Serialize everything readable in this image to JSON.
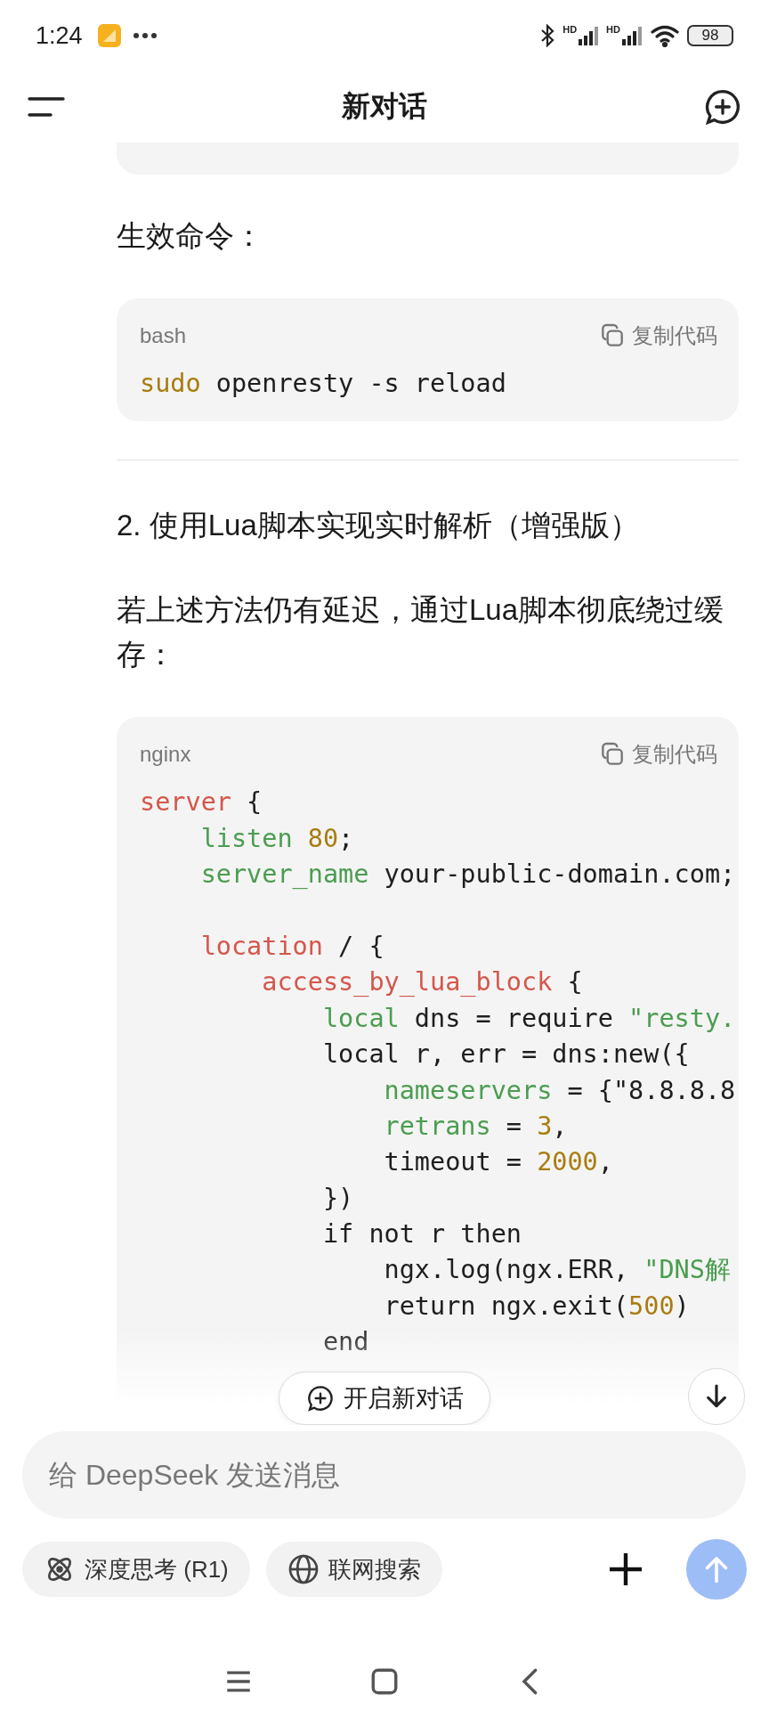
{
  "status_bar": {
    "time": "1:24",
    "signals": [
      {
        "label": "HD"
      },
      {
        "label": "HD"
      }
    ],
    "battery": "98"
  },
  "header": {
    "title": "新对话"
  },
  "content": {
    "intro": "生效命令：",
    "bash_block": {
      "language": "bash",
      "copy_label": "复制代码",
      "lines": [
        {
          "kind": "code",
          "tokens": [
            {
              "text": "sudo",
              "kind": "command"
            },
            {
              "text": " openresty -s reload",
              "kind": "plain"
            }
          ]
        }
      ]
    },
    "heading": "2. 使用Lua脚本实现实时解析（增强版）",
    "paragraph": "若上述方法仍有延迟，通过Lua脚本彻底绕过缓存：",
    "nginx_block": {
      "language": "nginx",
      "copy_label": "复制代码",
      "lines": [
        {
          "kind": "code",
          "tokens": [
            {
              "text": "server",
              "kind": "keyword"
            },
            {
              "text": " {",
              "kind": "plain"
            }
          ]
        },
        {
          "kind": "code",
          "tokens": [
            {
              "text": "    listen ",
              "kind": "name"
            },
            {
              "text": "80",
              "kind": "number"
            },
            {
              "text": ";",
              "kind": "plain"
            }
          ]
        },
        {
          "kind": "code",
          "tokens": [
            {
              "text": "    server_name",
              "kind": "name"
            },
            {
              "text": " your-public-domain.com;",
              "kind": "plain"
            }
          ]
        },
        {
          "kind": "blank"
        },
        {
          "kind": "code",
          "tokens": [
            {
              "text": "    location",
              "kind": "keyword"
            },
            {
              "text": " / {",
              "kind": "plain"
            }
          ]
        },
        {
          "kind": "code",
          "tokens": [
            {
              "text": "        access_by_lua_block",
              "kind": "keyword"
            },
            {
              "text": " {",
              "kind": "plain"
            }
          ]
        },
        {
          "kind": "code",
          "tokens": [
            {
              "text": "            local",
              "kind": "name"
            },
            {
              "text": " dns = require ",
              "kind": "plain"
            },
            {
              "text": "\"resty.",
              "kind": "string"
            }
          ]
        },
        {
          "kind": "code",
          "tokens": [
            {
              "text": "            local r, err = dns:new({",
              "kind": "plain"
            }
          ]
        },
        {
          "kind": "code",
          "tokens": [
            {
              "text": "                nameservers",
              "kind": "name"
            },
            {
              "text": " = {\"8.8.8.8",
              "kind": "plain"
            }
          ]
        },
        {
          "kind": "code",
          "tokens": [
            {
              "text": "                retrans",
              "kind": "name"
            },
            {
              "text": " = ",
              "kind": "plain"
            },
            {
              "text": "3",
              "kind": "number"
            },
            {
              "text": ",",
              "kind": "plain"
            }
          ]
        },
        {
          "kind": "code",
          "tokens": [
            {
              "text": "                timeout = ",
              "kind": "plain"
            },
            {
              "text": "2000",
              "kind": "number"
            },
            {
              "text": ",",
              "kind": "plain"
            }
          ]
        },
        {
          "kind": "code",
          "tokens": [
            {
              "text": "            })",
              "kind": "plain"
            }
          ]
        },
        {
          "kind": "code",
          "tokens": [
            {
              "text": "            if not r then",
              "kind": "plain"
            }
          ]
        },
        {
          "kind": "code",
          "tokens": [
            {
              "text": "                ngx.log(ngx.ERR, ",
              "kind": "plain"
            },
            {
              "text": "\"DNS解",
              "kind": "string"
            }
          ]
        },
        {
          "kind": "code",
          "tokens": [
            {
              "text": "                return ngx.exit(",
              "kind": "plain"
            },
            {
              "text": "500",
              "kind": "number"
            },
            {
              "text": ")",
              "kind": "plain"
            }
          ]
        },
        {
          "kind": "code",
          "tokens": [
            {
              "text": "            end",
              "kind": "plain"
            }
          ]
        }
      ]
    },
    "new_chat_button": "开启新对话"
  },
  "composer": {
    "placeholder": "给 DeepSeek 发送消息",
    "chips": [
      {
        "label": "深度思考 (R1)",
        "selected": false
      },
      {
        "label": "联网搜索",
        "selected": false
      }
    ],
    "send_button": {
      "disabled": true
    }
  }
}
